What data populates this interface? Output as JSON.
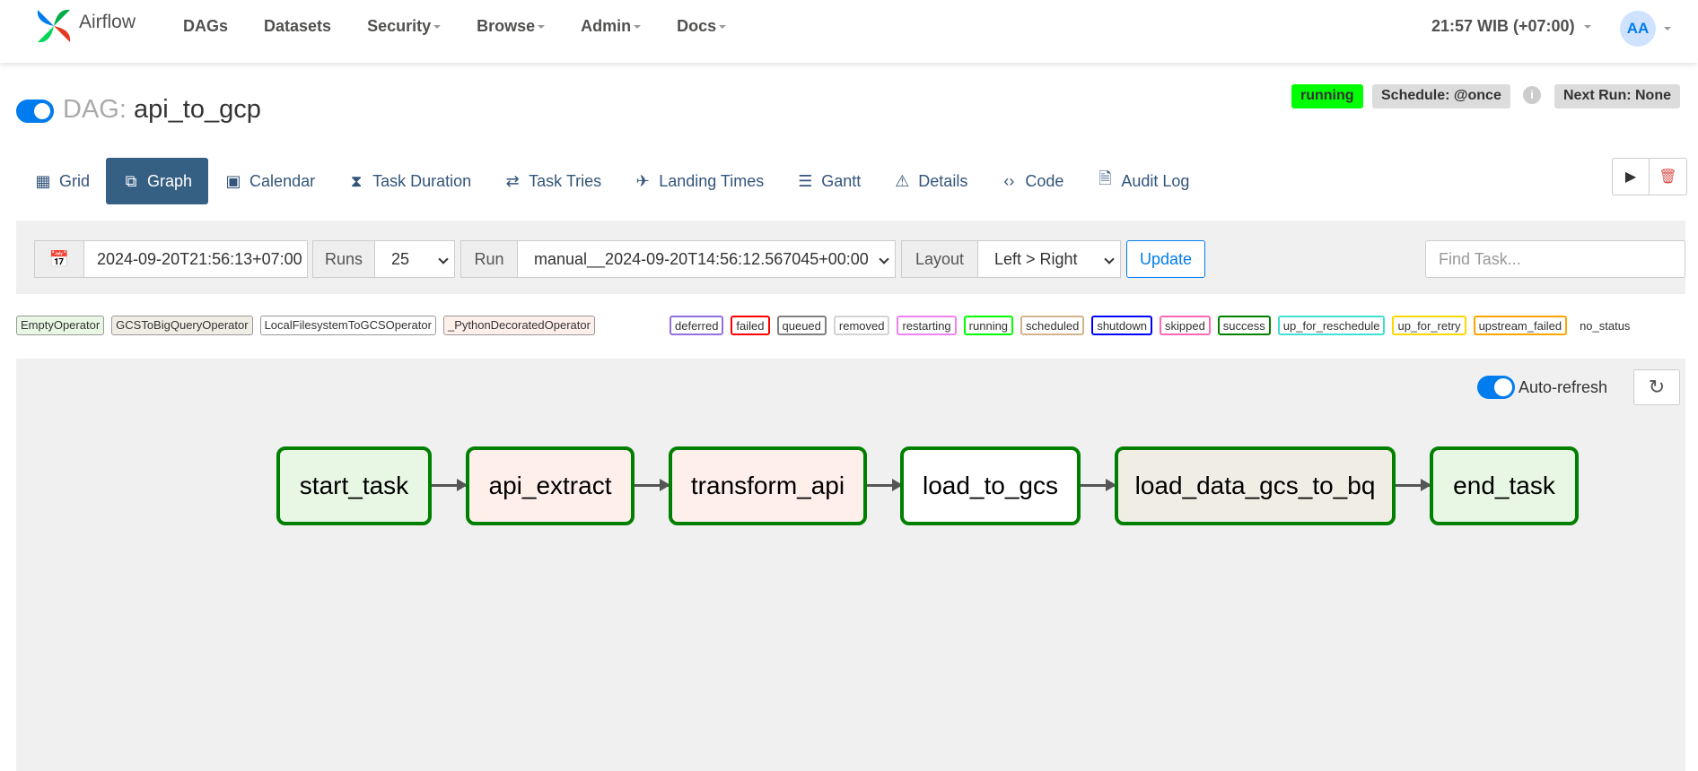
{
  "brand": {
    "name": "Airflow"
  },
  "nav": {
    "items": [
      {
        "label": "DAGs",
        "dropdown": false
      },
      {
        "label": "Datasets",
        "dropdown": false
      },
      {
        "label": "Security",
        "dropdown": true
      },
      {
        "label": "Browse",
        "dropdown": true
      },
      {
        "label": "Admin",
        "dropdown": true
      },
      {
        "label": "Docs",
        "dropdown": true
      }
    ],
    "clock": "21:57 WIB (+07:00)",
    "avatar": "AA"
  },
  "dag": {
    "prefix": "DAG:",
    "name": "api_to_gcp",
    "state": "running",
    "schedule": "Schedule: @once",
    "next_run": "Next Run: None",
    "paused": false
  },
  "tabs": [
    {
      "label": "Grid",
      "icon": "grid-icon"
    },
    {
      "label": "Graph",
      "icon": "graph-icon",
      "active": true
    },
    {
      "label": "Calendar",
      "icon": "calendar-icon"
    },
    {
      "label": "Task Duration",
      "icon": "hourglass-icon"
    },
    {
      "label": "Task Tries",
      "icon": "repeat-icon"
    },
    {
      "label": "Landing Times",
      "icon": "plane-landing-icon"
    },
    {
      "label": "Gantt",
      "icon": "gantt-icon"
    },
    {
      "label": "Details",
      "icon": "warning-triangle-icon"
    },
    {
      "label": "Code",
      "icon": "code-icon"
    },
    {
      "label": "Audit Log",
      "icon": "file-search-icon"
    }
  ],
  "filters": {
    "base_date": "2024-09-20T21:56:13+07:00",
    "runs_label": "Runs",
    "runs_value": "25",
    "run_label": "Run",
    "run_value": "manual__2024-09-20T14:56:12.567045+00:00",
    "layout_label": "Layout",
    "layout_value": "Left > Right",
    "update_label": "Update",
    "find_placeholder": "Find Task..."
  },
  "operator_legend": [
    {
      "label": "EmptyOperator",
      "bg": "#e8f7e4"
    },
    {
      "label": "GCSToBigQueryOperator",
      "bg": "#f0eee4"
    },
    {
      "label": "LocalFilesystemToGCSOperator",
      "bg": "#ffffff"
    },
    {
      "label": "_PythonDecoratedOperator",
      "bg": "#ffefeb"
    }
  ],
  "state_legend": [
    {
      "label": "deferred",
      "color": "#9370db"
    },
    {
      "label": "failed",
      "color": "#ff0000"
    },
    {
      "label": "queued",
      "color": "#808080"
    },
    {
      "label": "removed",
      "color": "#d3d3d3"
    },
    {
      "label": "restarting",
      "color": "#ee82ee"
    },
    {
      "label": "running",
      "color": "#00ff00"
    },
    {
      "label": "scheduled",
      "color": "#d2b48c"
    },
    {
      "label": "shutdown",
      "color": "#0000ff"
    },
    {
      "label": "skipped",
      "color": "#ff69b4"
    },
    {
      "label": "success",
      "color": "#008000"
    },
    {
      "label": "up_for_reschedule",
      "color": "#40e0d0"
    },
    {
      "label": "up_for_retry",
      "color": "#ffd700"
    },
    {
      "label": "upstream_failed",
      "color": "#ffa500"
    },
    {
      "label": "no_status",
      "color": "none"
    }
  ],
  "graph": {
    "auto_refresh_label": "Auto-refresh",
    "auto_refresh_on": true,
    "nodes": [
      {
        "label": "start_task",
        "bg": "#e8f7e4",
        "state": "success"
      },
      {
        "label": "api_extract",
        "bg": "#ffefeb",
        "state": "success"
      },
      {
        "label": "transform_api",
        "bg": "#ffefeb",
        "state": "success"
      },
      {
        "label": "load_to_gcs",
        "bg": "#ffffff",
        "state": "success"
      },
      {
        "label": "load_data_gcs_to_bq",
        "bg": "#f0eee4",
        "state": "success"
      },
      {
        "label": "end_task",
        "bg": "#e8f7e4",
        "state": "success"
      }
    ]
  },
  "colors": {
    "accent": "#017cee",
    "tab_active": "#365f84",
    "success_border": "#008000"
  }
}
